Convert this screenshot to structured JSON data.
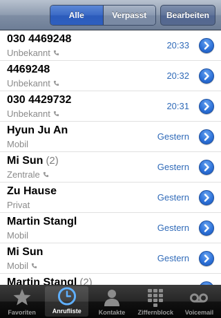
{
  "navbar": {
    "segments": [
      "Alle",
      "Verpasst"
    ],
    "selected_segment": "Alle",
    "edit_label": "Bearbeiten"
  },
  "calls": [
    {
      "name": "030 4469248",
      "count": "",
      "label": "Unbekannt",
      "phone_icon": true,
      "time": "20:33"
    },
    {
      "name": "4469248",
      "count": "",
      "label": "Unbekannt",
      "phone_icon": true,
      "time": "20:32"
    },
    {
      "name": "030 4429732",
      "count": "",
      "label": "Unbekannt",
      "phone_icon": true,
      "time": "20:31"
    },
    {
      "name": "Hyun Ju An",
      "count": "",
      "label": "Mobil",
      "phone_icon": false,
      "time": "Gestern"
    },
    {
      "name": "Mi Sun",
      "count": "(2)",
      "label": "Zentrale",
      "phone_icon": true,
      "time": "Gestern"
    },
    {
      "name": "Zu Hause",
      "count": "",
      "label": "Privat",
      "phone_icon": false,
      "time": "Gestern"
    },
    {
      "name": "Martin Stangl",
      "count": "",
      "label": "Mobil",
      "phone_icon": false,
      "time": "Gestern"
    },
    {
      "name": "Mi Sun",
      "count": "",
      "label": "Mobil",
      "phone_icon": true,
      "time": "Gestern"
    },
    {
      "name": "Martin Stangl",
      "count": "(2)",
      "label": "",
      "phone_icon": false,
      "time": ""
    }
  ],
  "tabbar": {
    "tabs": [
      {
        "label": "Favoriten",
        "icon": "star-icon",
        "active": false
      },
      {
        "label": "Anrufliste",
        "icon": "clock-icon",
        "active": true
      },
      {
        "label": "Kontakte",
        "icon": "person-icon",
        "active": false
      },
      {
        "label": "Ziffernblock",
        "icon": "keypad-icon",
        "active": false
      },
      {
        "label": "Voicemail",
        "icon": "voicemail-icon",
        "active": false
      }
    ]
  },
  "colors": {
    "time_text": "#2f6ab8",
    "disclosure_blue": "#2f73d9",
    "segment_selected": "#3b6ac6"
  }
}
